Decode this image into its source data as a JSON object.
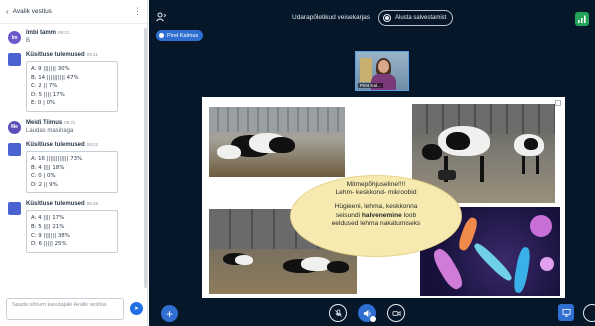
{
  "chat": {
    "header_title": "Avalik vestlus",
    "messages": [
      {
        "avatar": "Im",
        "avatar_color": "#6a5acd",
        "name": "Imbi tamm",
        "time": "09:21",
        "text": "B"
      },
      {
        "avatar": "",
        "avatar_color": "#4a63d0",
        "name": "Küsitluse tulemused",
        "time": "09:21",
        "poll": [
          "A: 9 ||||||| 30%",
          "B: 14 |||||||||| 47%",
          "C: 2 || 7%",
          "D: 5 |||| 17%",
          "E: 0 | 0%"
        ]
      },
      {
        "avatar": "Me",
        "avatar_color": "#5a4fb8",
        "name": "Meidi Tiimus",
        "time": "09:21",
        "text": "Laudas masinaga"
      },
      {
        "avatar": "",
        "avatar_color": "#4a63d0",
        "name": "Küsitluse tulemused",
        "time": "09:22",
        "poll": [
          "A: 16 |||||||||||| 73%",
          "B: 4 |||| 18%",
          "C: 0 | 0%",
          "D: 2 || 9%"
        ]
      },
      {
        "avatar": "",
        "avatar_color": "#4a63d0",
        "name": "Küsitluse tulemused",
        "time": "09:25",
        "poll": [
          "A: 4 |||| 17%",
          "B: 5 |||| 21%",
          "C: 9 ||||||| 38%",
          "D: 6 ||||| 25%"
        ]
      }
    ],
    "input_placeholder": "Saada sõnum kasutajale Avalik vestlus"
  },
  "topbar": {
    "session_title": "Udarapõletikud veisekarjas",
    "record_label": "Alusta salvestamist",
    "presenter": "Piret Kalmus"
  },
  "webcam": {
    "label": "Piret Kal..."
  },
  "slide": {
    "line1": "Mitmepõhjuseline!!!!",
    "line2": "Lehm- keskkond- mikroobid",
    "line3": "Hügieeni, lehma, keskkonna",
    "line4_pre": "seisundi ",
    "line4_bold": "halvenemine",
    "line4_post": " loob",
    "line5": "eeldused lehma nakatumiseks"
  },
  "colors": {
    "main_bg": "#06172a",
    "accent_blue": "#2f6fd1",
    "signal_green": "#22a35a",
    "bubble": "#f6eab0"
  }
}
